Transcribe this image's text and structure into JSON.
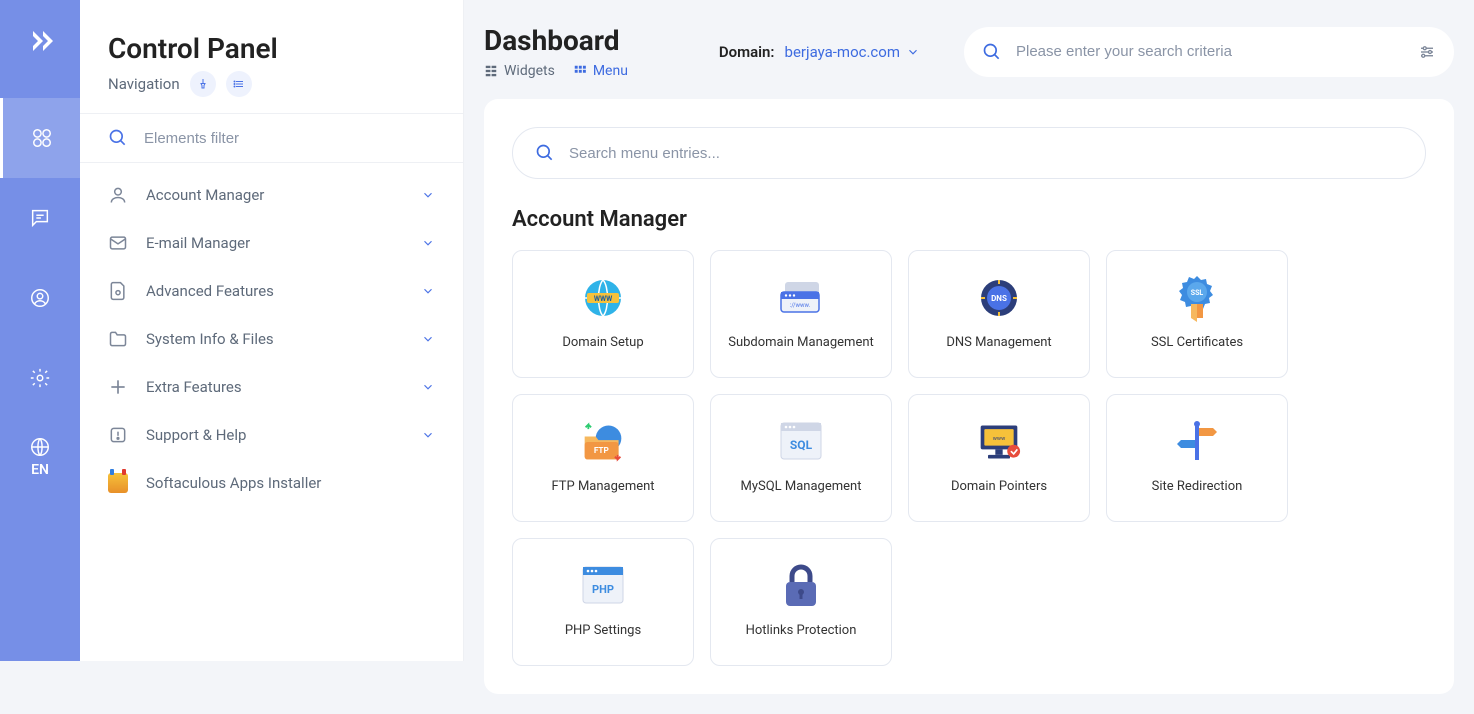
{
  "rail": {
    "lang": "EN"
  },
  "sidebar": {
    "title": "Control Panel",
    "subtitle": "Navigation",
    "filter_placeholder": "Elements filter",
    "items": [
      {
        "label": "Account Manager"
      },
      {
        "label": "E-mail Manager"
      },
      {
        "label": "Advanced Features"
      },
      {
        "label": "System Info & Files"
      },
      {
        "label": "Extra Features"
      },
      {
        "label": "Support & Help"
      },
      {
        "label": "Softaculous Apps Installer"
      }
    ]
  },
  "header": {
    "title": "Dashboard",
    "widgets_label": "Widgets",
    "menu_label": "Menu",
    "domain_label": "Domain:",
    "domain_value": "berjaya-moc.com",
    "search_placeholder": "Please enter your search criteria"
  },
  "panel": {
    "inner_search_placeholder": "Search menu entries...",
    "section_title": "Account Manager",
    "cards": [
      {
        "label": "Domain Setup"
      },
      {
        "label": "Subdomain Management"
      },
      {
        "label": "DNS Management"
      },
      {
        "label": "SSL Certificates"
      },
      {
        "label": "FTP Management"
      },
      {
        "label": "MySQL Management"
      },
      {
        "label": "Domain Pointers"
      },
      {
        "label": "Site Redirection"
      },
      {
        "label": "PHP Settings"
      },
      {
        "label": "Hotlinks Protection"
      }
    ]
  }
}
